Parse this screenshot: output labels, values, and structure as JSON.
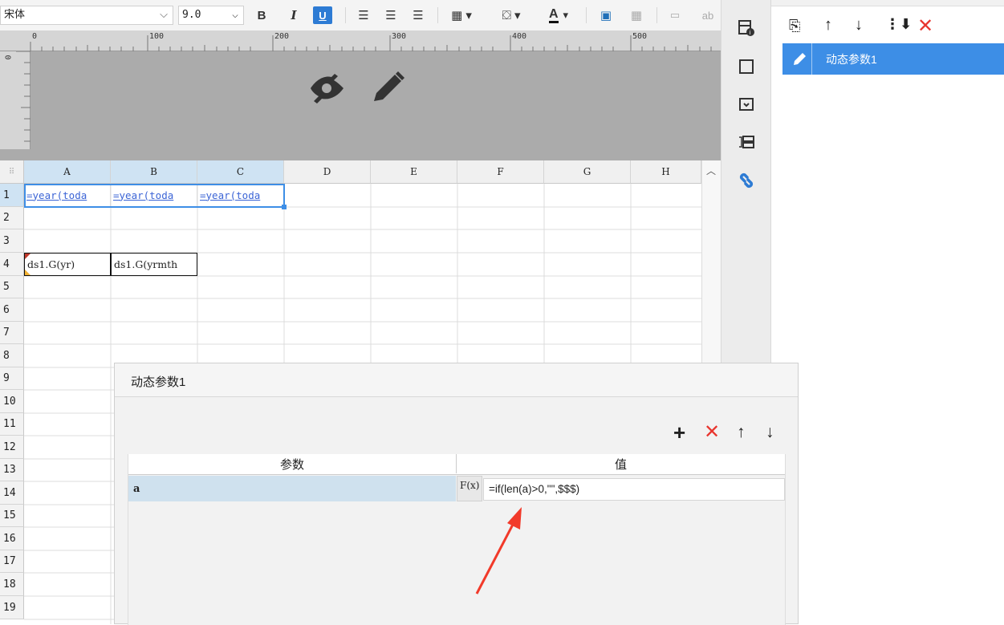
{
  "toolbar": {
    "font_name": "宋体",
    "font_size": "9.0",
    "bold": "B",
    "italic": "I",
    "underline": "U",
    "text_label": "ab"
  },
  "ruler": {
    "ticks": [
      "0",
      "100",
      "200",
      "300",
      "400",
      "500"
    ],
    "v_tick": "0"
  },
  "grid": {
    "columns": [
      "A",
      "B",
      "C",
      "D",
      "E",
      "F",
      "G",
      "H"
    ],
    "rows": [
      "1",
      "2",
      "3",
      "4",
      "5",
      "6",
      "7",
      "8",
      "9",
      "10",
      "11",
      "12",
      "13",
      "14",
      "15",
      "16",
      "17",
      "18",
      "19"
    ],
    "cells": {
      "A1": "=year(toda",
      "B1": "=year(toda",
      "C1": "=year(toda",
      "A4": "ds1.G(yr)",
      "B4": "ds1.G(yrmth"
    }
  },
  "right_panel": {
    "items": [
      {
        "label": "动态参数1",
        "selected": true
      }
    ]
  },
  "dialog": {
    "title": "动态参数1",
    "columns": {
      "param": "参数",
      "value": "值"
    },
    "rows": [
      {
        "param": "a",
        "fx": "F(x)",
        "value": "=if(len(a)>0,\"\",$$$)"
      }
    ]
  },
  "colors": {
    "accent": "#3d8ee6",
    "selected_row": "#cfe1ee",
    "delete_red": "#e8352e",
    "arrow_red": "#f23a2a"
  }
}
